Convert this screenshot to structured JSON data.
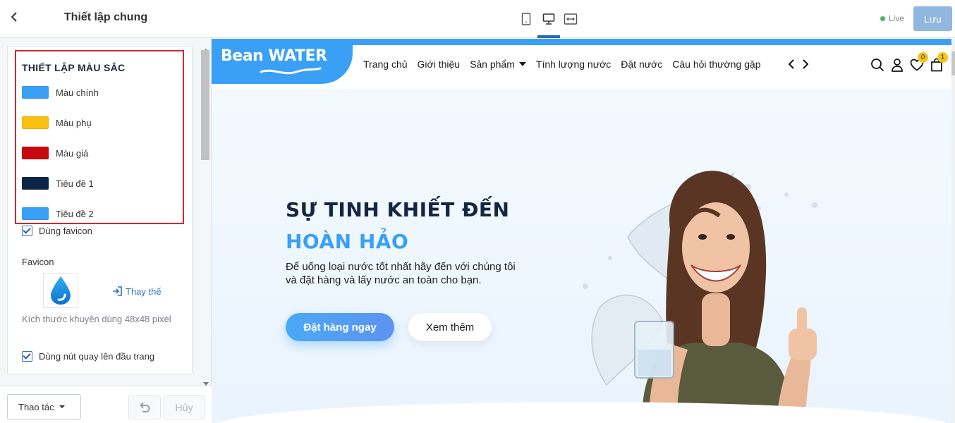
{
  "left_panel": {
    "title": "Thiết lập chung",
    "section_title": "THIẾT LẬP MÀU SẮC",
    "colors": [
      {
        "label": "Màu chính",
        "color": "#3aa0f5"
      },
      {
        "label": "Màu phụ",
        "color": "#fbc00f"
      },
      {
        "label": "Màu giá",
        "color": "#c8090c"
      },
      {
        "label": "Tiêu đề 1",
        "color": "#0c2447"
      },
      {
        "label": "Tiêu đề 2",
        "color": "#3aa0f5"
      }
    ],
    "use_favicon_label": "Dùng favicon",
    "use_favicon_checked": true,
    "favicon_label": "Favicon",
    "replace_label": "Thay thế",
    "size_hint": "Kích thước khuyên dùng 48x48 pixel",
    "back_to_top_label": "Dùng nút quay lên đầu trang",
    "back_to_top_checked": true
  },
  "footer": {
    "actions_label": "Thao tác",
    "cancel_label": "Hủy"
  },
  "toolbar": {
    "devices": [
      "mobile-icon",
      "desktop-icon",
      "fullscreen-icon"
    ],
    "active_device": "desktop-icon",
    "status_label": "Live",
    "status_color": "#4cbb5e",
    "save_label": "Lưu"
  },
  "site": {
    "logo_text": "Bean WATER",
    "brand_color": "#3aa0f5",
    "nav": [
      "Trang chủ",
      "Giới thiệu",
      "Sản phẩm",
      "Tính lượng nước",
      "Đặt nước",
      "Câu hỏi thường gặp"
    ],
    "wishlist_count": "0",
    "cart_count": "1",
    "hero": {
      "title_line1": "SỰ TINH KHIẾT ĐẾN",
      "title_line2": "HOÀN HẢO",
      "description": "Để uống loại nước tốt nhất hãy đến với chúng tôi và đặt hàng và lấy nước an toàn cho bạn.",
      "primary_cta": "Đặt hàng ngay",
      "secondary_cta": "Xem thêm"
    }
  }
}
